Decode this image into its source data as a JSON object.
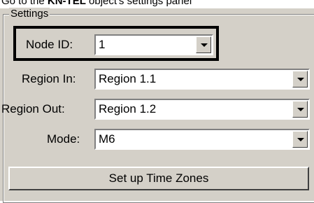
{
  "caption": {
    "prefix": "Go to the ",
    "bold": "KN-TEL",
    "suffix": " object's settings panel"
  },
  "group": {
    "legend": "Settings"
  },
  "fields": [
    {
      "label": "Node ID:",
      "value": "1"
    },
    {
      "label": "Region In:",
      "value": "Region 1.1"
    },
    {
      "label": "Region Out:",
      "value": "Region 1.2"
    },
    {
      "label": "Mode:",
      "value": "M6"
    }
  ],
  "button": {
    "label": "Set up Time Zones"
  }
}
